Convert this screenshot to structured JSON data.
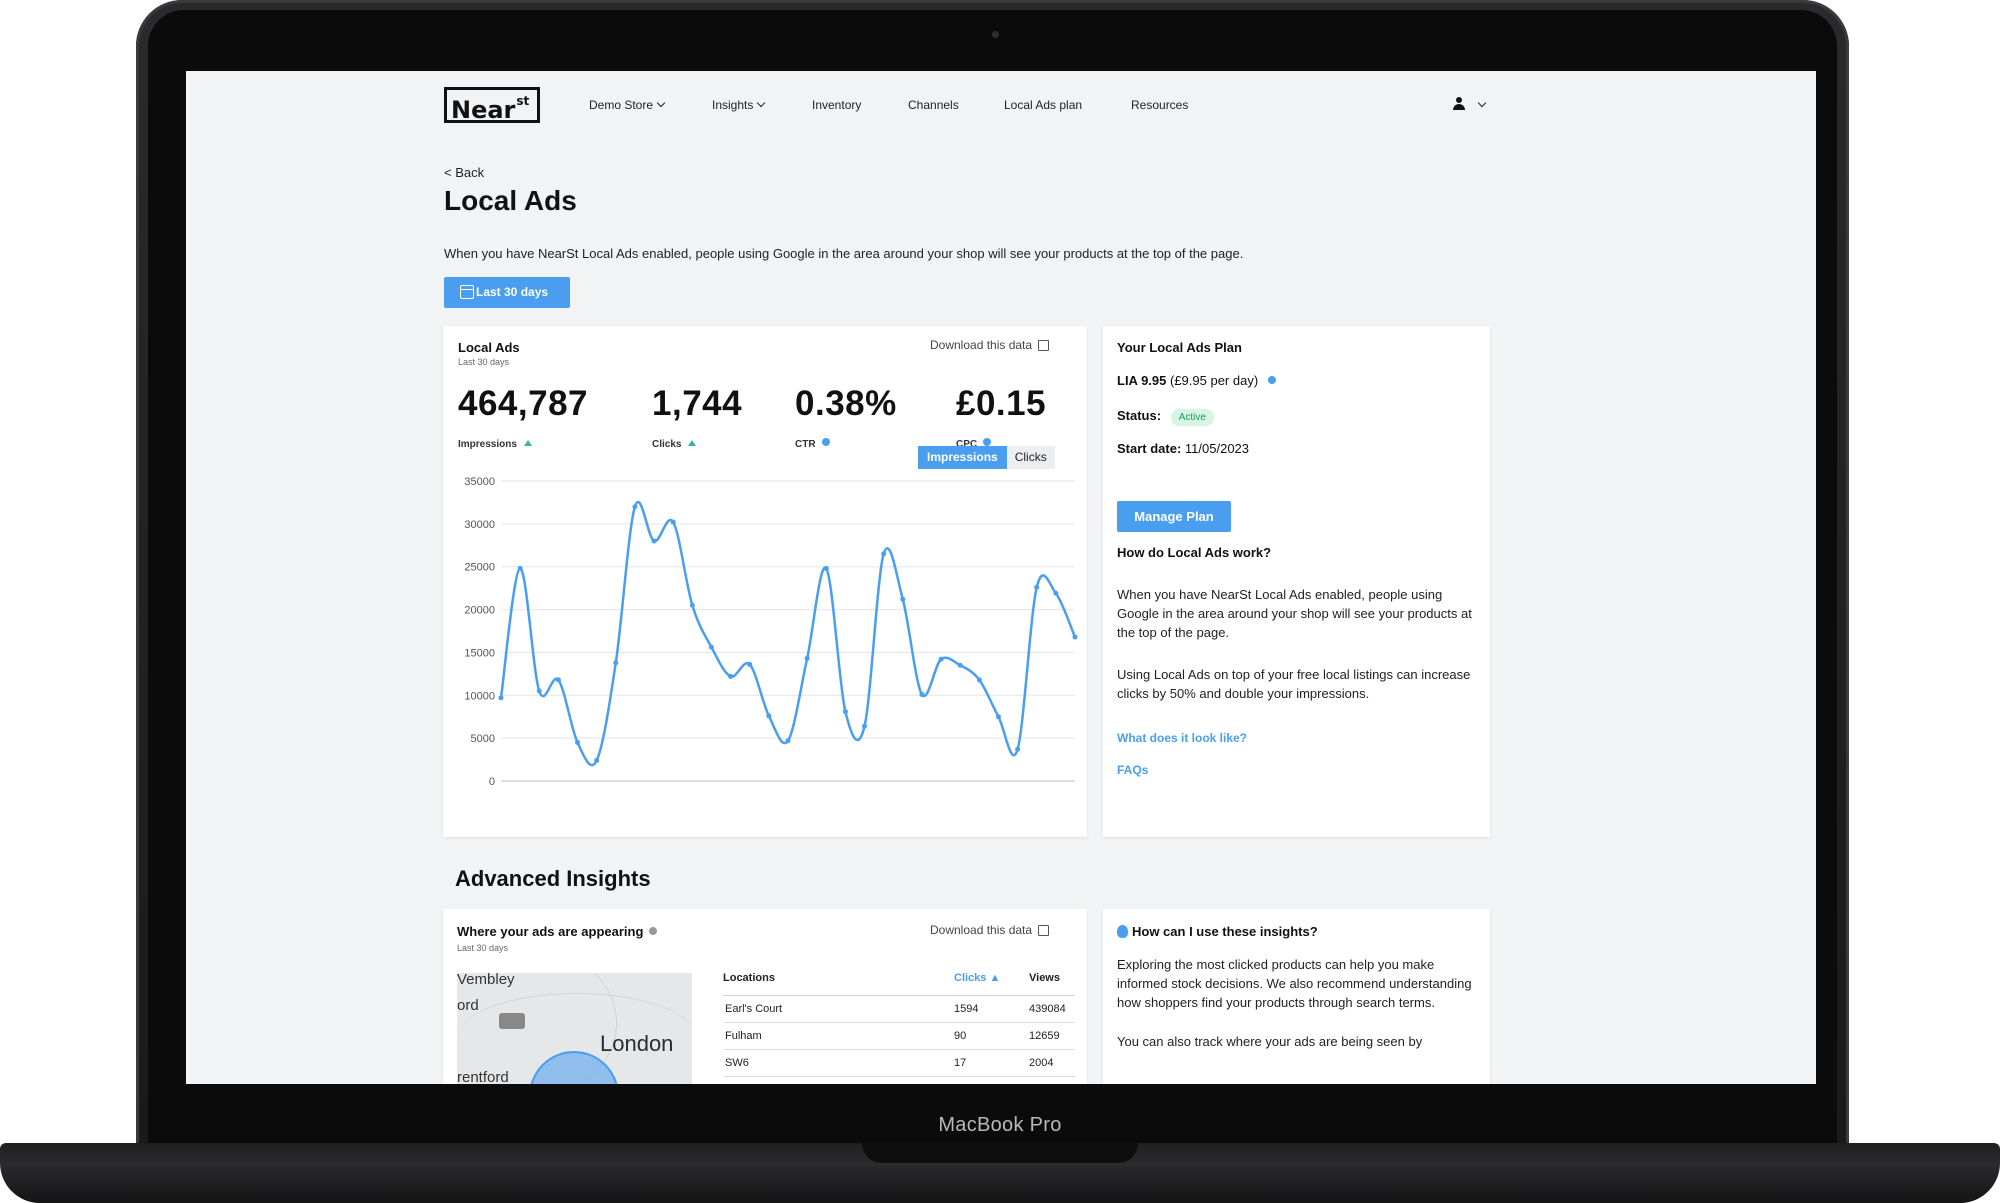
{
  "device": {
    "label": "MacBook Pro"
  },
  "nav": {
    "logo_text": "Near",
    "logo_sup": "st",
    "items": [
      {
        "label": "Demo Store",
        "dropdown": true
      },
      {
        "label": "Insights",
        "dropdown": true
      },
      {
        "label": "Inventory",
        "dropdown": false
      },
      {
        "label": "Channels",
        "dropdown": false
      },
      {
        "label": "Local Ads plan",
        "dropdown": false
      },
      {
        "label": "Resources",
        "dropdown": false
      }
    ]
  },
  "page": {
    "back_label": "< Back",
    "title": "Local Ads",
    "description": "When you have NearSt Local Ads enabled, people using Google in the area around your shop will see your products at the top of the page.",
    "date_range_label": "Last 30 days"
  },
  "local_ads_card": {
    "title": "Local Ads",
    "subtitle": "Last 30 days",
    "download_label": "Download this data",
    "metrics": [
      {
        "value": "464,787",
        "label": "Impressions",
        "indicator": "up"
      },
      {
        "value": "1,744",
        "label": "Clicks",
        "indicator": "up"
      },
      {
        "value": "0.38%",
        "label": "CTR",
        "indicator": "info"
      },
      {
        "value": "£0.15",
        "label": "CPC",
        "indicator": "info"
      }
    ],
    "toggle": {
      "impressions_label": "Impressions",
      "clicks_label": "Clicks",
      "active": "Impressions"
    }
  },
  "chart_data": {
    "type": "line",
    "title": "",
    "xlabel": "",
    "ylabel": "",
    "ylim": [
      0,
      35000
    ],
    "yticks": [
      0,
      5000,
      10000,
      15000,
      20000,
      25000,
      30000,
      35000
    ],
    "grid": true,
    "color": "#4a9ef0",
    "series": [
      {
        "values": [
          9700,
          24800,
          10500,
          11800,
          4500,
          2400,
          13800,
          32000,
          28000,
          30200,
          20500,
          15600,
          12200,
          13600,
          7600,
          4700,
          14300,
          24800,
          8100,
          6400,
          26500,
          21200,
          10100,
          14200,
          13500,
          11800,
          7500,
          3700,
          22600,
          21900,
          16800
        ]
      }
    ]
  },
  "plan_card": {
    "title": "Your Local Ads Plan",
    "plan_name": "LIA 9.95",
    "plan_price": "(£9.95 per day)",
    "status_label": "Status:",
    "status_value": "Active",
    "start_label": "Start date:",
    "start_value": "11/05/2023",
    "manage_button": "Manage Plan",
    "how_title": "How do Local Ads work?",
    "how_para1": "When you have NearSt Local Ads enabled, people using Google in the area around your shop will see your products at the top of the page.",
    "how_para2": "Using Local Ads on top of your free local listings can increase clicks by 50% and double your impressions.",
    "link1": "What does it look like?",
    "link2": "FAQs"
  },
  "advanced": {
    "title": "Advanced Insights",
    "where_card": {
      "title": "Where your ads are appearing",
      "subtitle": "Last 30 days",
      "download_label": "Download this data",
      "map_labels": [
        "Vembley",
        "ord",
        "London",
        "rentford"
      ],
      "table": {
        "headers": [
          "Locations",
          "Clicks ▲",
          "Views"
        ],
        "rows": [
          [
            "Earl's Court",
            "1594",
            "439084"
          ],
          [
            "Fulham",
            "90",
            "12659"
          ],
          [
            "SW6",
            "17",
            "2004"
          ]
        ]
      }
    },
    "how_card": {
      "title": "How can I use these insights?",
      "para1": "Exploring the most clicked products can help you make informed stock decisions. We also recommend understanding how shoppers find your products through search terms.",
      "para2": "You can also track where your ads are being seen by"
    }
  }
}
